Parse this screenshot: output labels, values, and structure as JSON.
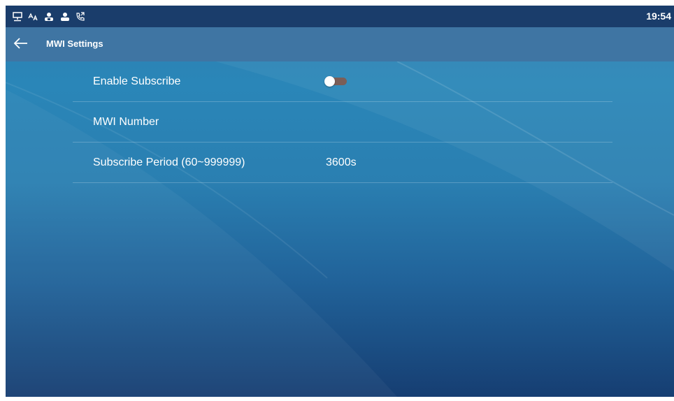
{
  "status_bar": {
    "icons": [
      "network-icon",
      "language-icon",
      "contacts-icon",
      "account-icon",
      "call-forward-icon"
    ],
    "time": "19:54"
  },
  "header": {
    "back_icon": "arrow-left-icon",
    "title": "MWI Settings"
  },
  "settings": [
    {
      "label": "Enable Subscribe",
      "type": "toggle",
      "enabled": false
    },
    {
      "label": "MWI Number",
      "type": "text",
      "value": ""
    },
    {
      "label": "Subscribe Period (60~999999)",
      "type": "text",
      "value": "3600s"
    }
  ],
  "colors": {
    "status_bar_bg": "#1a3d6b",
    "title_bar_bg": "#3f75a3",
    "toggle_off_track": "#7b5e58",
    "text": "#ffffff"
  }
}
